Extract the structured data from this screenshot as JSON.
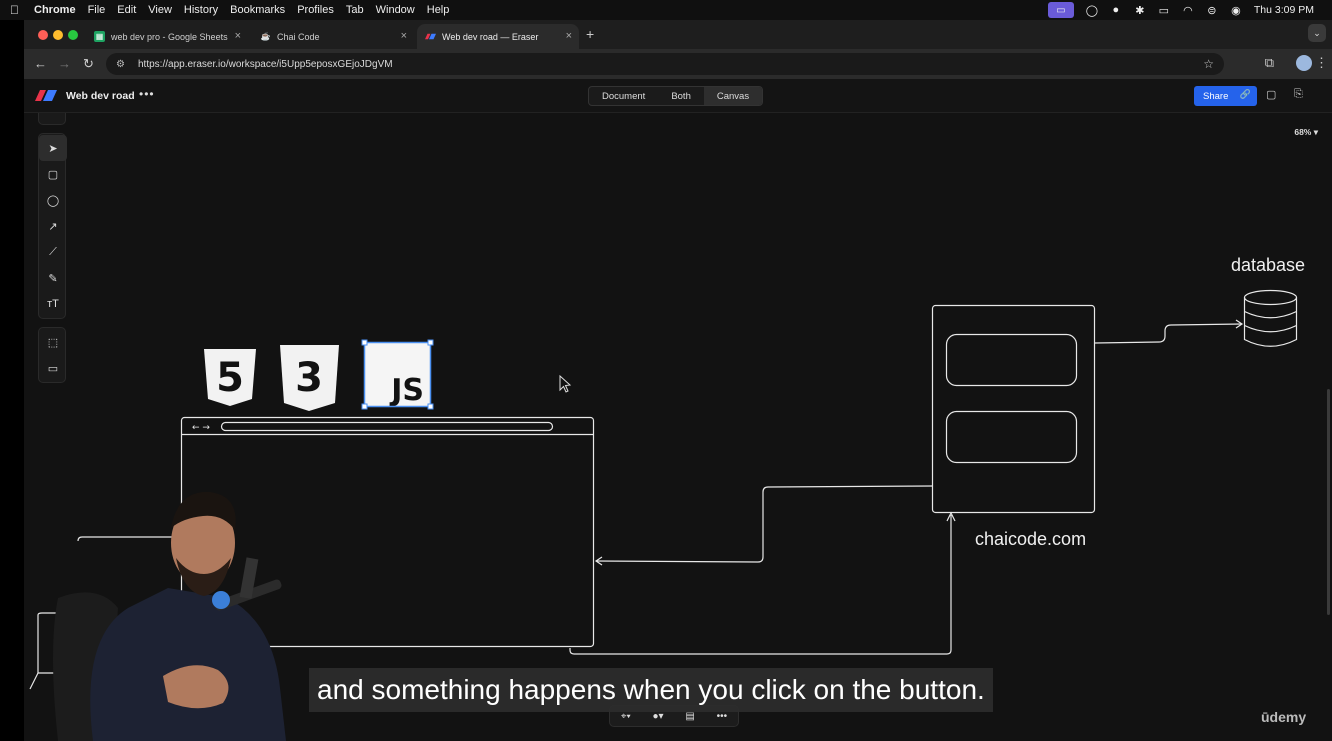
{
  "menubar": {
    "app": "Chrome",
    "items": [
      "File",
      "Edit",
      "View",
      "History",
      "Bookmarks",
      "Profiles",
      "Tab",
      "Window",
      "Help"
    ],
    "clock": "Thu 3:09 PM"
  },
  "tabs": [
    {
      "title": "web dev pro - Google Sheets",
      "icon": "google-sheets-icon"
    },
    {
      "title": "Chai Code",
      "icon": "chai-cup-icon"
    },
    {
      "title": "Web dev road — Eraser",
      "icon": "eraser-logo-icon",
      "active": true
    }
  ],
  "address": {
    "url": "https://app.eraser.io/workspace/i5Upp5eposxGEjoJDgVM"
  },
  "app": {
    "title": "Web dev road",
    "modes": [
      "Document",
      "Both",
      "Canvas"
    ],
    "active_mode": "Canvas",
    "share_label": "Share",
    "zoom": "68%"
  },
  "canvas": {
    "database_label": "database",
    "server_label": "chaicode.com",
    "html_badge": "5",
    "css_badge": "3",
    "js_badge": "JS",
    "browser_nav": "← →"
  },
  "caption": "and something happens when you click on the button.",
  "watermark": "ūdemy",
  "colors": {
    "accent": "#2563eb",
    "selection": "#4a8ff0",
    "menubar_tray": "#6a5bd8"
  }
}
